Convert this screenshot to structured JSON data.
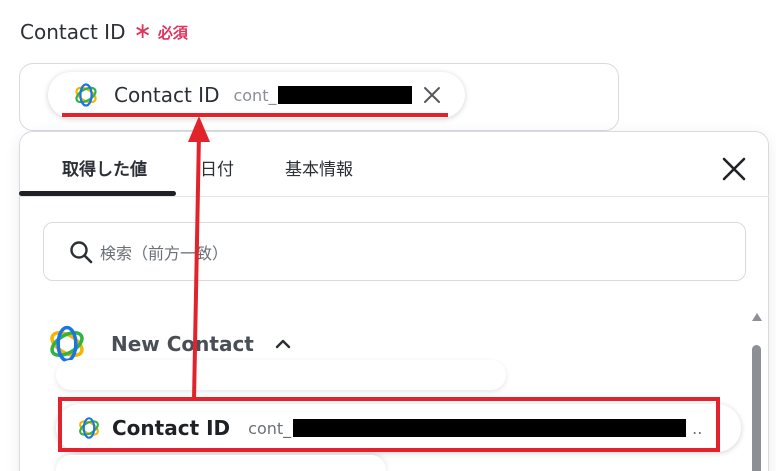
{
  "field": {
    "label": "Contact ID",
    "required_mark": "∗",
    "required_text": "必須"
  },
  "chip": {
    "label": "Contact ID",
    "value_prefix": "cont_",
    "close_icon": "close-icon"
  },
  "tabs": [
    {
      "label": "取得した値",
      "active": true
    },
    {
      "label": "日付",
      "active": false
    },
    {
      "label": "基本情報",
      "active": false
    }
  ],
  "search": {
    "placeholder": "検索（前方一致）"
  },
  "group": {
    "title": "New Contact",
    "expanded": true
  },
  "item": {
    "label": "Contact ID",
    "value_prefix": "cont_",
    "ellipsis": ".."
  },
  "colors": {
    "accent_red": "#e3232b",
    "required_pink": "#e2315a",
    "text_dark": "#2b2f36",
    "muted": "#6b7078",
    "border": "#d7dbe0"
  }
}
